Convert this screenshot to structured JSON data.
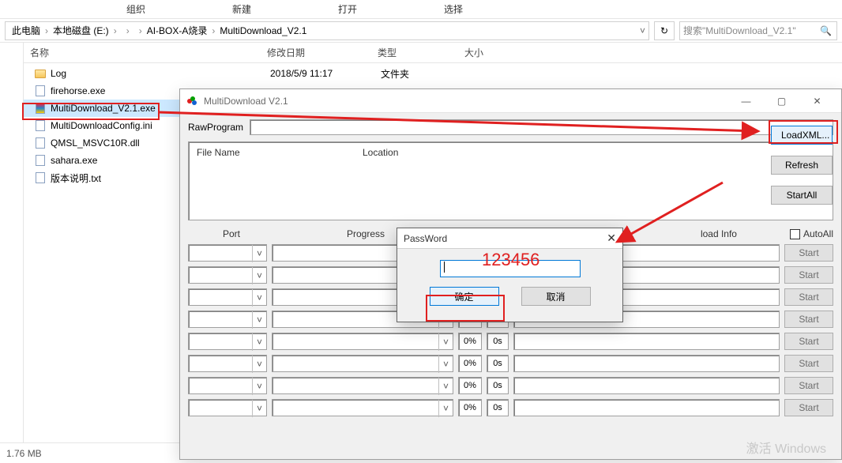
{
  "ribbon": {
    "org": "组织",
    "new": "新建",
    "open": "打开",
    "select": "选择"
  },
  "breadcrumb": {
    "root": "此电脑",
    "drive": "本地磁盘 (E:)",
    "d1": "",
    "d2": "",
    "d3": "AI-BOX-A烧录",
    "d4": "MultiDownload_V2.1"
  },
  "search": {
    "placeholder": "搜索\"MultiDownload_V2.1\""
  },
  "cols": {
    "name": "名称",
    "date": "修改日期",
    "type": "类型",
    "size": "大小"
  },
  "entries": {
    "folder1": {
      "name": "Log",
      "date": "2018/5/9 11:17",
      "type": "文件夹"
    },
    "f1": "firehorse.exe",
    "f2": "MultiDownload_V2.1.exe",
    "f3": "MultiDownloadConfig.ini",
    "f4": "QMSL_MSVC10R.dll",
    "f5": "sahara.exe",
    "f6": "版本说明.txt"
  },
  "status": {
    "size": "1.76 MB"
  },
  "md": {
    "title": "MultiDownload V2.1",
    "rawprogram_label": "RawProgram",
    "loadxml": "LoadXML...",
    "refresh": "Refresh",
    "startall": "StartAll",
    "autoall": "AutoAll",
    "filename_col": "File Name",
    "location_col": "Location",
    "head_port": "Port",
    "head_progress": "Progress",
    "head_info": "load Info",
    "start": "Start",
    "pct": "0%",
    "tm": "0s"
  },
  "pwd": {
    "title": "PassWord",
    "ok": "确定",
    "cancel": "取消",
    "annotation": "123456"
  },
  "watermark": "激活 Windows"
}
